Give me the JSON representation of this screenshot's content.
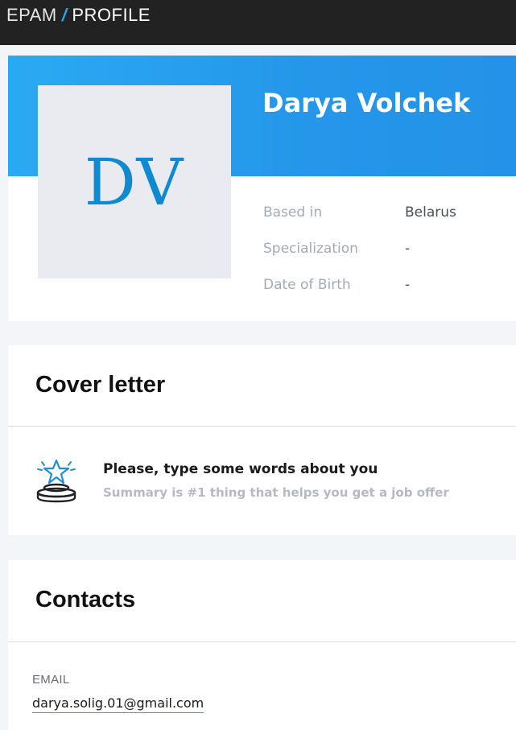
{
  "header": {
    "brand_primary": "EPAM",
    "brand_separator": "/",
    "brand_secondary": "PROFILE"
  },
  "profile": {
    "initials": "DV",
    "name": "Darya Volchek",
    "fields": [
      {
        "label": "Based in",
        "value": "Belarus"
      },
      {
        "label": "Specialization",
        "value": "-"
      },
      {
        "label": "Date of Birth",
        "value": "-"
      }
    ]
  },
  "cover_letter": {
    "title": "Cover letter",
    "prompt_heading": "Please, type some words about you",
    "prompt_subtext": "Summary is #1 thing that helps you get a job offer",
    "icon": "star-podium-icon"
  },
  "contacts": {
    "title": "Contacts",
    "email_label": "EMAIL",
    "email_value": "darya.solig.01@gmail.com"
  },
  "colors": {
    "accent": "#2596ea",
    "topbar": "#222222",
    "avatar_initials": "#0f8ad0"
  }
}
